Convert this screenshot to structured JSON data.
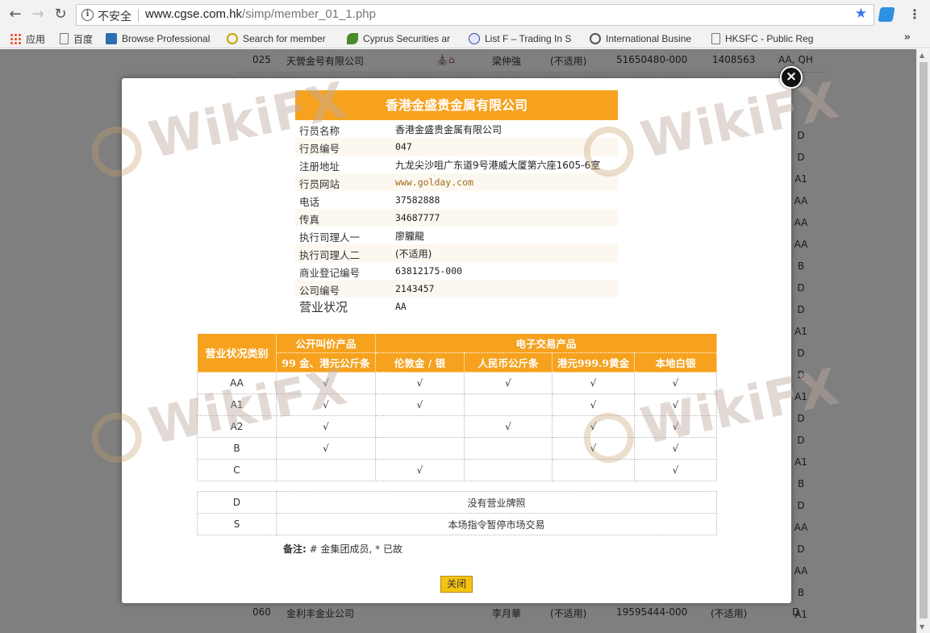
{
  "browser": {
    "security_label": "不安全",
    "url_host": "www.cgse.com.hk",
    "url_path": "/simp/member_01_1.php",
    "bookmarks": [
      {
        "label": "应用",
        "icon": "apps-icon"
      },
      {
        "label": "百度",
        "icon": "page-icon"
      },
      {
        "label": "Browse Professional",
        "icon": "site-icon"
      },
      {
        "label": "Search for member",
        "icon": "site-icon"
      },
      {
        "label": "Cyprus Securities ar",
        "icon": "site-icon"
      },
      {
        "label": "List F – Trading In S",
        "icon": "site-icon"
      },
      {
        "label": "International Busine",
        "icon": "site-icon"
      },
      {
        "label": "HKSFC - Public Reg",
        "icon": "page-icon"
      }
    ],
    "more_bookmarks": "»"
  },
  "background_rows": [
    {
      "no": "025",
      "name": "天營金号有限公司",
      "person": "梁仲強",
      "na": "(不适用)",
      "biz_reg": "51650480-000",
      "company_no": "1408563",
      "status": "AA, QH"
    },
    {
      "no": "060",
      "name": "金利丰金业公司",
      "person": "李月華",
      "na": "(不适用)",
      "biz_reg": "19595444-000",
      "company_no": "(不适用)",
      "status": "D"
    }
  ],
  "background_status_codes": [
    "D",
    "D",
    "A1",
    "AA",
    "AA",
    "AA",
    "B",
    "D",
    "D",
    "A1",
    "D",
    "D",
    "A1",
    "D",
    "D",
    "A1",
    "B",
    "D",
    "AA",
    "D",
    "AA",
    "B",
    "A1"
  ],
  "member": {
    "title": "香港金盛贵金属有限公司",
    "fields": [
      {
        "label": "行员名称",
        "value": "香港金盛贵金属有限公司",
        "type": "cn"
      },
      {
        "label": "行员编号",
        "value": "047",
        "type": "mono"
      },
      {
        "label": "注册地址",
        "value": "九龙尖沙咀广东道9号港威大厦第六座1605-6室",
        "type": "cn"
      },
      {
        "label": "行员网站",
        "value": "www.golday.com",
        "type": "link"
      },
      {
        "label": "电话",
        "value": "37582888",
        "type": "mono"
      },
      {
        "label": "传真",
        "value": "34687777",
        "type": "mono"
      },
      {
        "label": "执行司理人一",
        "value": "廖朧龍",
        "type": "cn"
      },
      {
        "label": "执行司理人二",
        "value": "(不适用)",
        "type": "cn"
      },
      {
        "label": "商业登记编号",
        "value": "63812175-000",
        "type": "mono"
      },
      {
        "label": "公司编号",
        "value": "2143457",
        "type": "mono"
      },
      {
        "label": "营业状况",
        "value": "AA",
        "type": "mono"
      }
    ]
  },
  "category_table": {
    "header_category": "营业状况类别",
    "group_public": "公开叫价产品",
    "group_electronic": "电子交易产品",
    "col_public": "99 金、港元公斤条",
    "col_loco": "伦敦金 / 银",
    "col_rmb": "人民币公斤条",
    "col_hkd999": "港元999.9黄金",
    "col_silver": "本地白银",
    "check": "√",
    "rows": [
      {
        "code": "AA",
        "marks": [
          1,
          1,
          1,
          1,
          1
        ]
      },
      {
        "code": "A1",
        "marks": [
          1,
          1,
          0,
          1,
          1
        ]
      },
      {
        "code": "A2",
        "marks": [
          1,
          0,
          1,
          1,
          1
        ]
      },
      {
        "code": "B",
        "marks": [
          1,
          0,
          0,
          1,
          1
        ]
      },
      {
        "code": "C",
        "marks": [
          0,
          1,
          0,
          0,
          1
        ]
      }
    ]
  },
  "other_status": [
    {
      "code": "D",
      "desc": "没有营业牌照"
    },
    {
      "code": "S",
      "desc": "本场指令暂停市场交易"
    }
  ],
  "note": {
    "label": "备注:",
    "text": " # 金集团成员, * 已故"
  },
  "close_button": "关闭",
  "watermark_text": "WikiFX"
}
